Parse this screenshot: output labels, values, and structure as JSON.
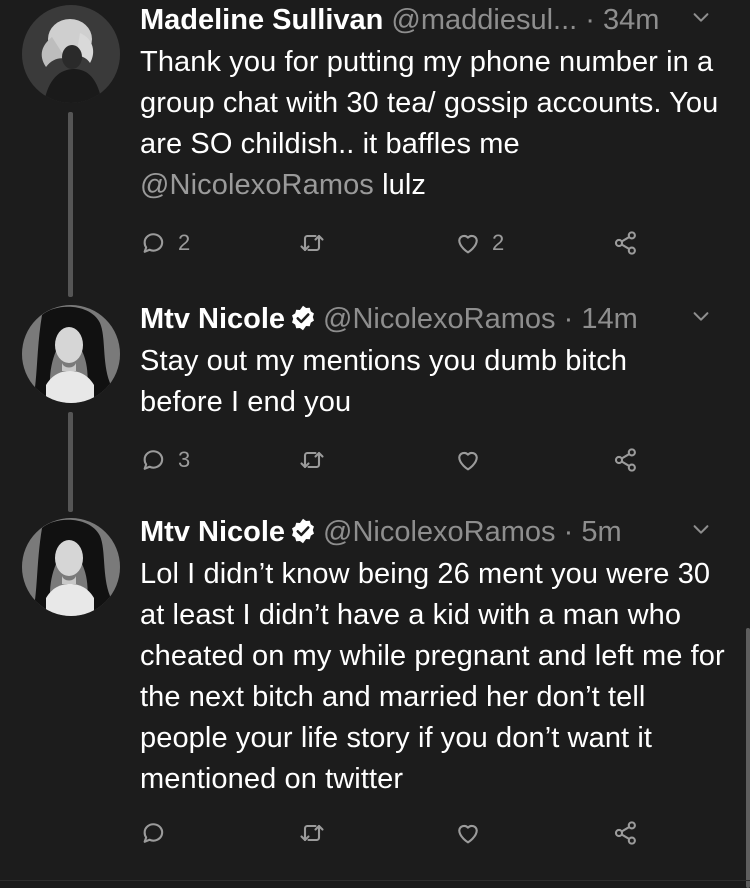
{
  "tweets": [
    {
      "name": "Madeline Sullivan",
      "handle": "@maddiesul...",
      "dot": "·",
      "time": "34m",
      "text_before": "Thank you for putting my phone number in a group chat with 30 tea/ gossip accounts. You are SO childish.. it baffles me ",
      "mention": "@NicolexoRamos",
      "text_after": " lulz",
      "reply_count": "2",
      "retweet_count": "",
      "like_count": "2",
      "verified": false
    },
    {
      "name": "Mtv Nicole",
      "handle": "@NicolexoRamos",
      "dot": "·",
      "time": "14m",
      "text": "Stay out my mentions you dumb bitch before I end you",
      "reply_count": "3",
      "retweet_count": "",
      "like_count": "",
      "verified": true
    },
    {
      "name": "Mtv Nicole",
      "handle": "@NicolexoRamos",
      "dot": "·",
      "time": "5m",
      "text": "Lol I didn’t know being 26 ment you were 30 at least I didn’t have a kid with a man who cheated on my while pregnant and left me for the next bitch and married her don’t tell people your life story if you don’t want it mentioned on twitter",
      "reply_count": "",
      "retweet_count": "",
      "like_count": "",
      "verified": true
    }
  ],
  "icons": {
    "reply": "reply-icon",
    "retweet": "retweet-icon",
    "like": "heart-icon",
    "share": "share-icon",
    "caret": "chevron-down-icon",
    "verified": "verified-badge-icon"
  },
  "colors": {
    "background": "#1c1c1c",
    "text": "#ffffff",
    "muted": "#8e8e8e",
    "icon": "#9b9b9b"
  }
}
